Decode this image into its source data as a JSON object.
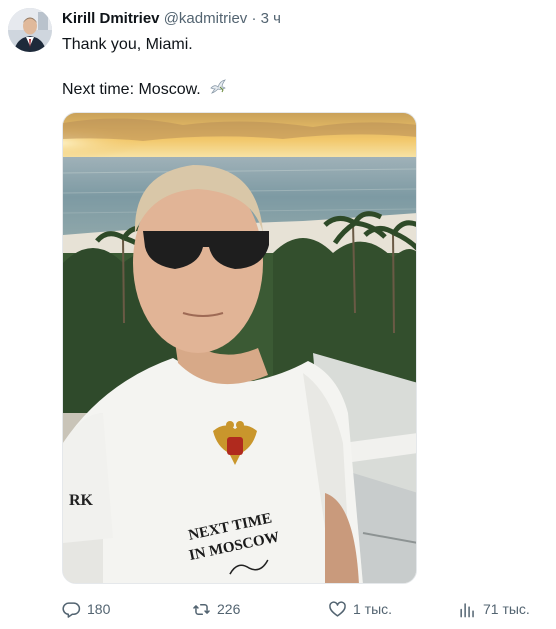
{
  "tweet": {
    "author": {
      "name": "Kirill Dmitriev",
      "handle": "@kadmitriev",
      "separator": "·",
      "time": "3 ч"
    },
    "text_lines": [
      "Thank you, Miami.",
      "Next time: Moscow."
    ],
    "text_emoji": "dove-emoji",
    "media": {
      "description_icon": "selfie-photo",
      "shirt_text_line1": "NEXT TIME",
      "shirt_text_line2": "IN MOSCOW",
      "sleeve_text": "RK"
    }
  },
  "actions": {
    "reply": {
      "icon": "reply-icon",
      "count": "180"
    },
    "retweet": {
      "icon": "retweet-icon",
      "count": "226"
    },
    "like": {
      "icon": "heart-icon",
      "count": "1 тыс."
    },
    "views": {
      "icon": "views-icon",
      "count": "71 тыс."
    }
  },
  "colors": {
    "text_primary": "#0f1419",
    "text_secondary": "#536471"
  }
}
